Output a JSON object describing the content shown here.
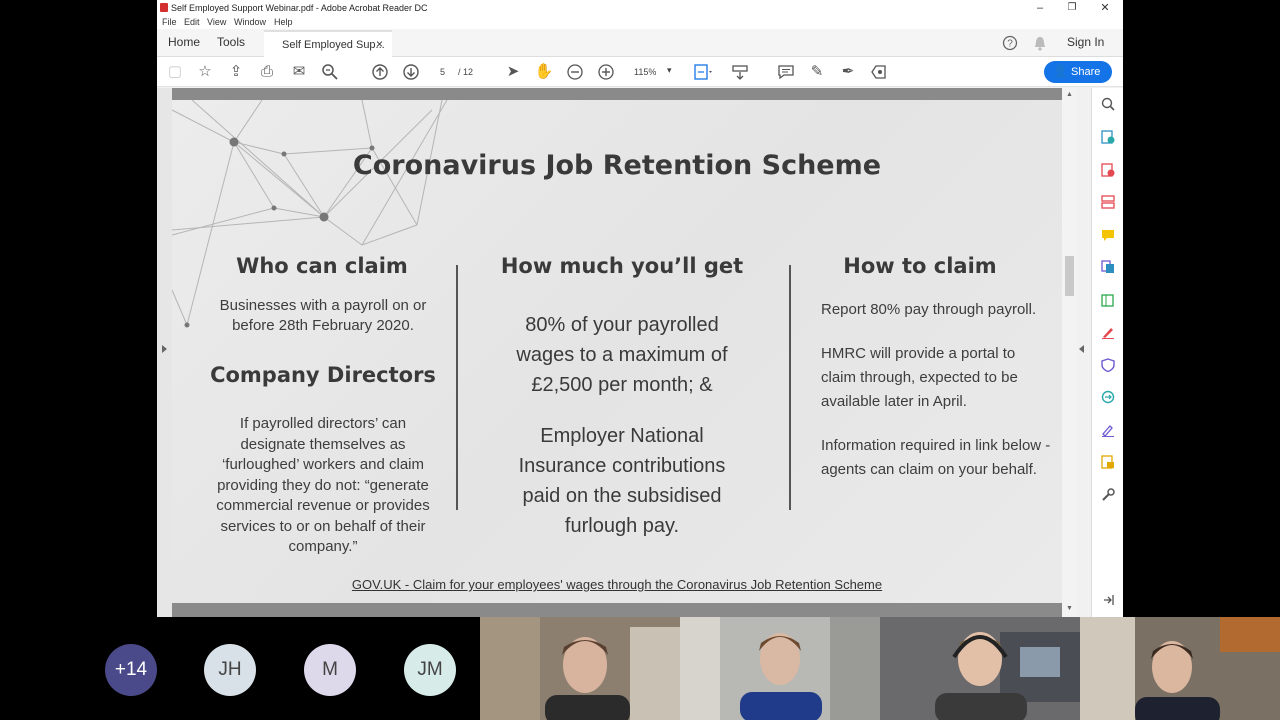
{
  "window": {
    "title": "Self Employed Support Webinar.pdf - Adobe Acrobat Reader DC",
    "minimize": "–",
    "restore": "❐",
    "close": "✕"
  },
  "menu": [
    "File",
    "Edit",
    "View",
    "Window",
    "Help"
  ],
  "tabs": {
    "home": "Home",
    "tools": "Tools",
    "document": "Self Employed Sup...",
    "close": "×"
  },
  "header_right": {
    "sign_in": "Sign In"
  },
  "toolbar": {
    "page_current": "5",
    "page_total": "/ 12",
    "zoom": "115%",
    "share": "Share"
  },
  "slide": {
    "title": "Coronavirus Job Retention Scheme",
    "col1": {
      "heading1": "Who can claim",
      "text1": "Businesses with a payroll on or before 28th February 2020.",
      "heading2": "Company Directors",
      "text2": "If payrolled directors’ can designate themselves as ‘furloughed’ workers and claim providing they do not: “generate commercial revenue or provides services to or on behalf of their company.”"
    },
    "col2": {
      "heading": "How much you’ll get",
      "text1": "80% of your payrolled wages to a maximum of £2,500 per month; &",
      "text2": "Employer National Insurance contributions paid on the subsidised furlough pay."
    },
    "col3": {
      "heading": "How to claim",
      "text1": "Report 80% pay through payroll.",
      "text2": "HMRC will provide a portal to claim through, expected to be available later in April.",
      "text3": "Information required in link below - agents can claim on your behalf."
    },
    "link": "GOV.UK - Claim for your employees' wages through the Coronavirus Job Retention Scheme"
  },
  "participants": {
    "more": "+14",
    "p1": "JH",
    "p2": "M",
    "p3": "JM"
  },
  "colors": {
    "accent": "#1473e6",
    "more_avatar": "#4a4a8a",
    "jh_avatar": "#d9e1e8",
    "m_avatar": "#ddd8ea",
    "jm_avatar": "#d7ece9"
  }
}
